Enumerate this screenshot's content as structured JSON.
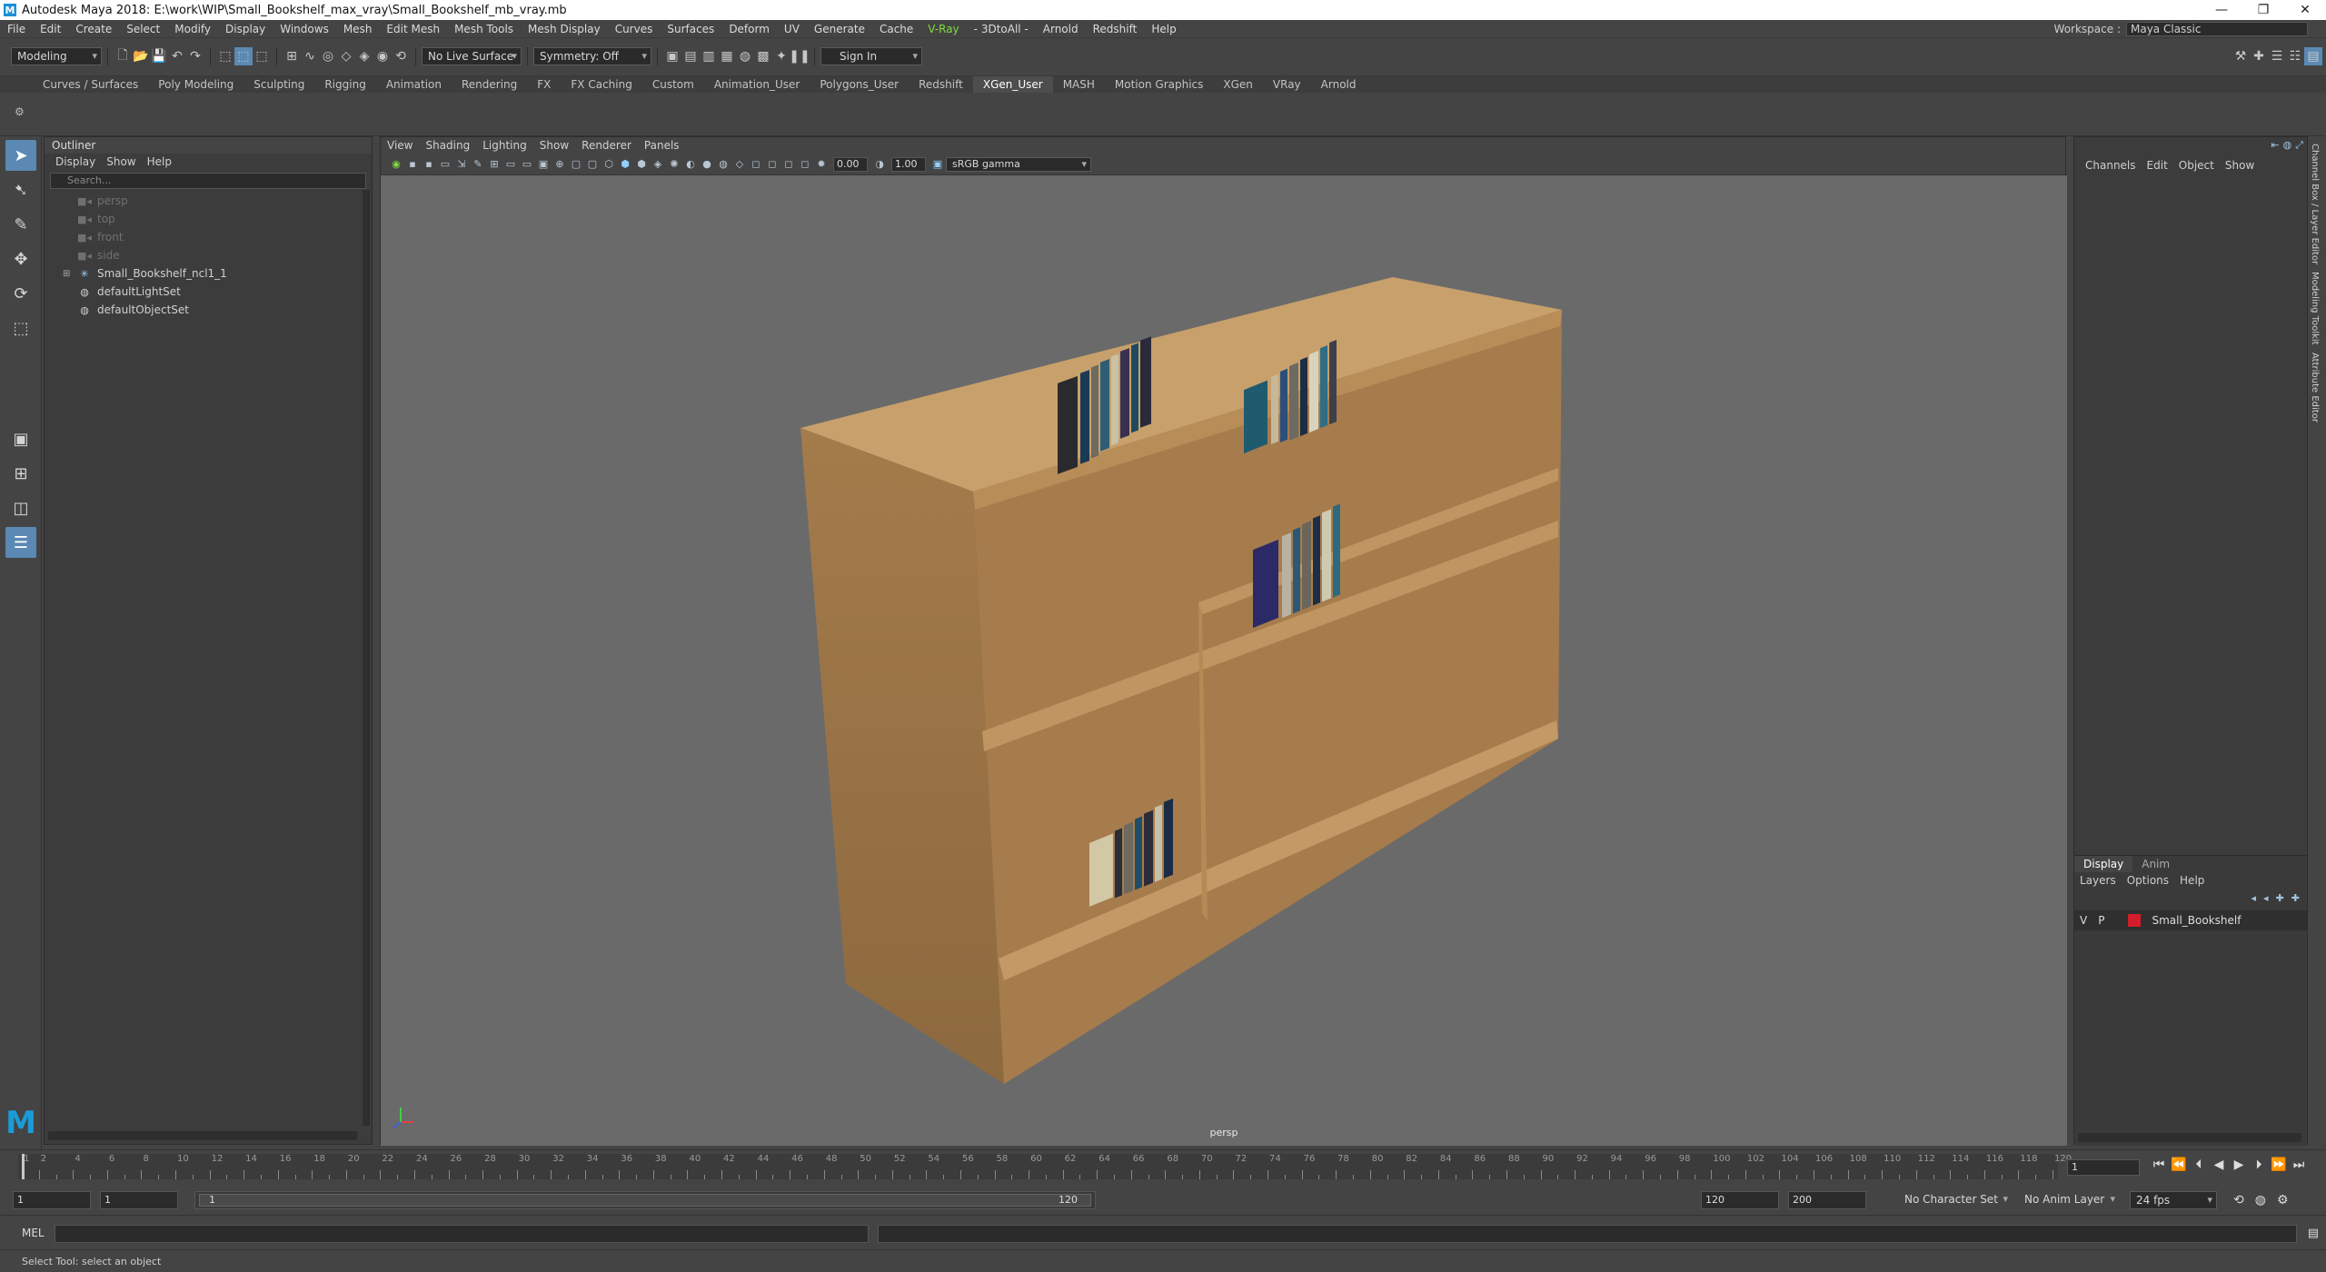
{
  "window": {
    "title": "Autodesk Maya 2018: E:\\work\\WIP\\Small_Bookshelf_max_vray\\Small_Bookshelf_mb_vray.mb",
    "logo": "M",
    "controls": [
      "—",
      "❐",
      "✕"
    ]
  },
  "menubar": {
    "items": [
      "File",
      "Edit",
      "Create",
      "Select",
      "Modify",
      "Display",
      "Windows",
      "Mesh",
      "Edit Mesh",
      "Mesh Tools",
      "Mesh Display",
      "Curves",
      "Surfaces",
      "Deform",
      "UV",
      "Generate",
      "Cache",
      "V-Ray",
      "- 3DtoAll -",
      "Arnold",
      "Redshift",
      "Help"
    ],
    "workspace_label": "Workspace :",
    "workspace_value": "Maya Classic"
  },
  "statusline": {
    "mode": "Modeling",
    "live_surface": "No Live Surface",
    "symmetry": "Symmetry: Off",
    "sign_in": "Sign In"
  },
  "shelf": {
    "tabs": [
      "Curves / Surfaces",
      "Poly Modeling",
      "Sculpting",
      "Rigging",
      "Animation",
      "Rendering",
      "FX",
      "FX Caching",
      "Custom",
      "Animation_User",
      "Polygons_User",
      "Redshift",
      "XGen_User",
      "MASH",
      "Motion Graphics",
      "XGen",
      "VRay",
      "Arnold"
    ],
    "active_tab": "XGen_User"
  },
  "outliner": {
    "title": "Outliner",
    "menu": [
      "Display",
      "Show",
      "Help"
    ],
    "search_placeholder": "Search...",
    "items": [
      {
        "label": "persp",
        "icon": "camera-icon",
        "dim": true
      },
      {
        "label": "top",
        "icon": "camera-icon",
        "dim": true
      },
      {
        "label": "front",
        "icon": "camera-icon",
        "dim": true
      },
      {
        "label": "side",
        "icon": "camera-icon",
        "dim": true
      },
      {
        "label": "Small_Bookshelf_ncl1_1",
        "icon": "group-icon",
        "dim": false
      },
      {
        "label": "defaultLightSet",
        "icon": "set-icon",
        "dim": false
      },
      {
        "label": "defaultObjectSet",
        "icon": "set-icon",
        "dim": false
      }
    ]
  },
  "viewport": {
    "menu": [
      "View",
      "Shading",
      "Lighting",
      "Show",
      "Renderer",
      "Panels"
    ],
    "exposure": "0.00",
    "gamma": "1.00",
    "color_space": "sRGB gamma",
    "camera": "persp"
  },
  "channelbox": {
    "menu": [
      "Channels",
      "Edit",
      "Object",
      "Show"
    ],
    "side_tabs": [
      "Channel Box / Layer Editor",
      "Modeling Toolkit",
      "Attribute Editor"
    ]
  },
  "layers": {
    "tabs": [
      "Display",
      "Anim"
    ],
    "active_tab": "Display",
    "menu": [
      "Layers",
      "Options",
      "Help"
    ],
    "layer": {
      "v": "V",
      "p": "P",
      "name": "Small_Bookshelf",
      "color": "#d21d2c"
    }
  },
  "timeslider": {
    "labels": [
      "1",
      "2",
      "4",
      "6",
      "8",
      "10",
      "12",
      "14",
      "16",
      "18",
      "20",
      "22",
      "24",
      "26",
      "28",
      "30",
      "32",
      "34",
      "36",
      "38",
      "40",
      "42",
      "44",
      "46",
      "48",
      "50",
      "52",
      "54",
      "56",
      "58",
      "60",
      "62",
      "64",
      "66",
      "68",
      "70",
      "72",
      "74",
      "76",
      "78",
      "80",
      "82",
      "84",
      "86",
      "88",
      "90",
      "92",
      "94",
      "96",
      "98",
      "100",
      "102",
      "104",
      "106",
      "108",
      "110",
      "112",
      "114",
      "116",
      "118",
      "120"
    ],
    "current_frame": "1"
  },
  "rangeslider": {
    "start": "1",
    "start2": "1",
    "range_start": "1",
    "range_end": "120",
    "end": "120",
    "end2": "200",
    "character_set": "No Character Set",
    "anim_layer": "No Anim Layer",
    "fps": "24 fps"
  },
  "cmdline": {
    "label": "MEL",
    "help": "Select Tool: select an object"
  }
}
